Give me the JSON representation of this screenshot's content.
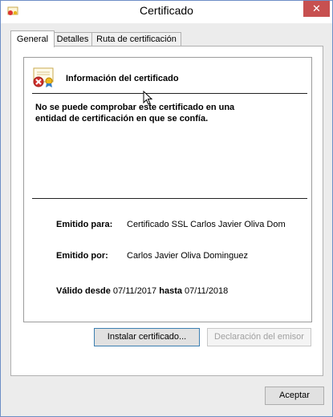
{
  "window": {
    "title": "Certificado",
    "close_glyph": "✕"
  },
  "tabs": [
    {
      "label": "General",
      "active": true
    },
    {
      "label": "Detalles",
      "active": false
    },
    {
      "label": "Ruta de certificación",
      "active": false
    }
  ],
  "info": {
    "title": "Información del certificado",
    "warning_line1": "No se puede comprobar este certificado en una",
    "warning_line2": "entidad de certificación en que se confía.",
    "issued_to_label": "Emitido para:",
    "issued_to_value": "Certificado SSL Carlos Javier Oliva Dom",
    "issued_by_label": "Emitido por:",
    "issued_by_value": "Carlos Javier Oliva Dominguez",
    "valid_from_label": "Válido desde",
    "valid_from_value": "07/11/2017",
    "valid_to_label": "hasta",
    "valid_to_value": "07/11/2018"
  },
  "buttons": {
    "install": "Instalar certificado...",
    "issuer_statement": "Declaración del emisor",
    "accept": "Aceptar"
  },
  "icons": {
    "app": "certificate-app-icon",
    "cert": "certificate-error-icon"
  },
  "colors": {
    "close": "#c75050",
    "border": "#6d8ec6"
  }
}
